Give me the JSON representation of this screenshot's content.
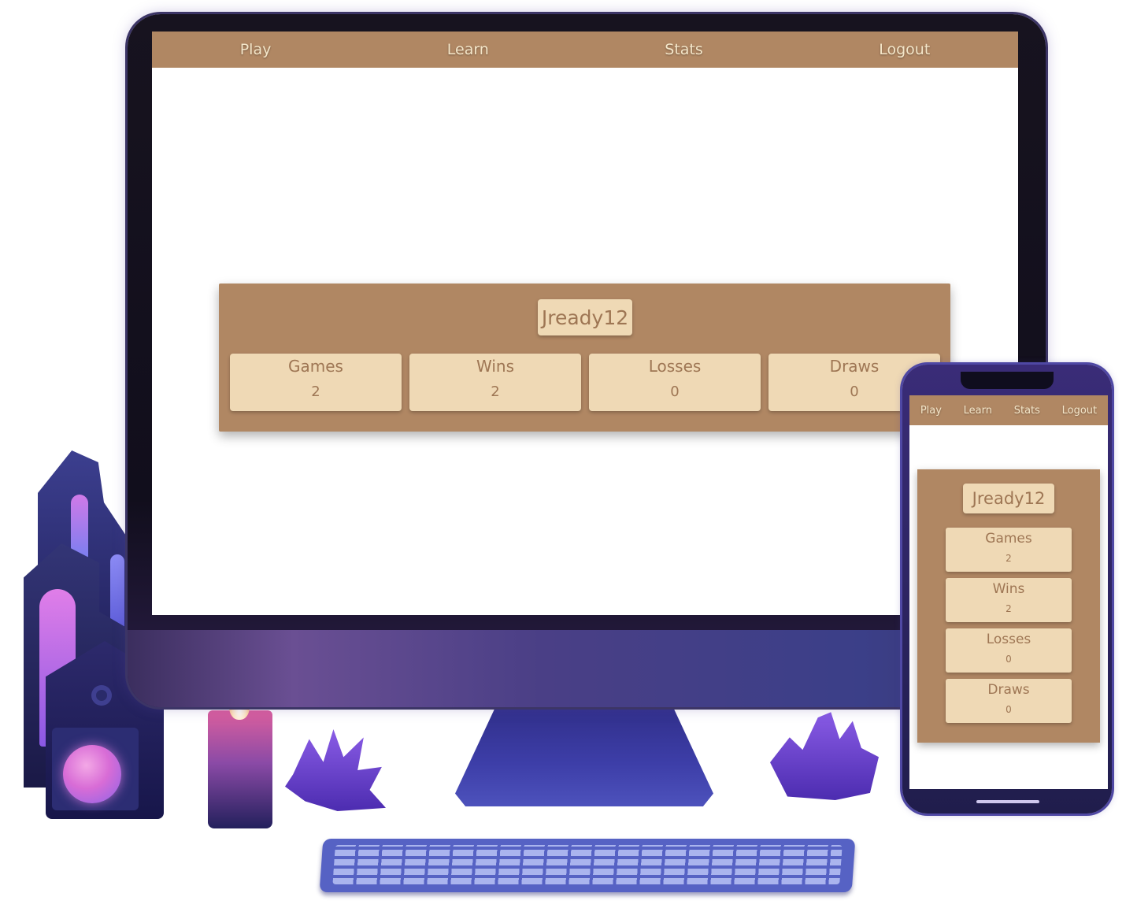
{
  "nav": {
    "items": [
      "Play",
      "Learn",
      "Stats",
      "Logout"
    ]
  },
  "profile": {
    "username": "Jready12",
    "stats": [
      {
        "label": "Games",
        "value": "2"
      },
      {
        "label": "Wins",
        "value": "2"
      },
      {
        "label": "Losses",
        "value": "0"
      },
      {
        "label": "Draws",
        "value": "0"
      }
    ]
  },
  "colors": {
    "nav_background": "#b08763",
    "card_background": "#b08763",
    "tile_background": "#efd9b5",
    "tile_text": "#9e7654",
    "nav_text": "#f4e6c9"
  },
  "icons": [
    "candle-icon",
    "castle-lamp-icon",
    "plant-icon",
    "keyboard-icon"
  ]
}
